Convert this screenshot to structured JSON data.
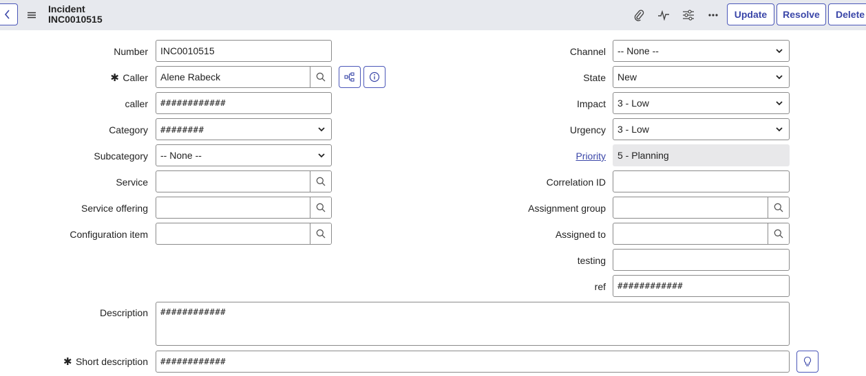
{
  "header": {
    "title": "Incident",
    "number": "INC0010515",
    "buttons": {
      "update": "Update",
      "resolve": "Resolve",
      "delete": "Delete"
    }
  },
  "form": {
    "number": {
      "label": "Number",
      "value": "INC0010515"
    },
    "caller": {
      "label": "Caller",
      "required_mark": "✱",
      "value": "Alene Rabeck"
    },
    "caller2": {
      "label": "caller",
      "value": "############"
    },
    "category": {
      "label": "Category",
      "value": "########"
    },
    "subcategory": {
      "label": "Subcategory",
      "value": "-- None --"
    },
    "service": {
      "label": "Service",
      "value": ""
    },
    "service_offering": {
      "label": "Service offering",
      "value": ""
    },
    "configuration_item": {
      "label": "Configuration item",
      "value": ""
    },
    "channel": {
      "label": "Channel",
      "value": "-- None --"
    },
    "state": {
      "label": "State",
      "value": "New"
    },
    "impact": {
      "label": "Impact",
      "value": "3 - Low"
    },
    "urgency": {
      "label": "Urgency",
      "value": "3 - Low"
    },
    "priority": {
      "label": "Priority",
      "value": "5 - Planning"
    },
    "correlation_id": {
      "label": "Correlation ID",
      "value": ""
    },
    "assignment_group": {
      "label": "Assignment group",
      "value": ""
    },
    "assigned_to": {
      "label": "Assigned to",
      "value": ""
    },
    "testing": {
      "label": "testing",
      "value": ""
    },
    "ref": {
      "label": "ref",
      "value": "############"
    },
    "description": {
      "label": "Description",
      "value": "############"
    },
    "short_description": {
      "label": "Short description",
      "required_mark": "✱",
      "value": "############"
    }
  },
  "colors": {
    "accent": "#4a56b8",
    "header_bg": "#e7e9ee",
    "readonly_bg": "#e8e8ea"
  }
}
